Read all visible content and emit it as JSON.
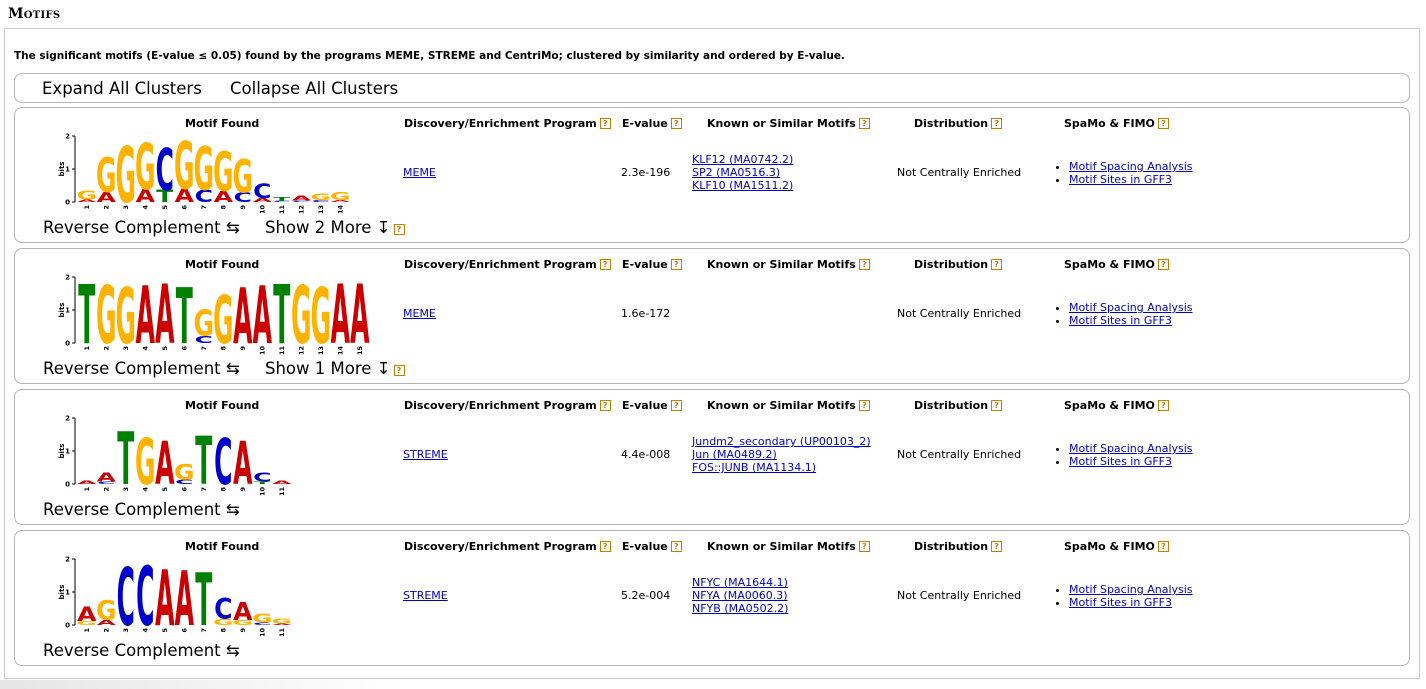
{
  "section": {
    "title": "Motifs"
  },
  "description": "The significant motifs (E-value ≤ 0.05) found by the programs MEME, STREME and CentriMo; clustered by similarity and ordered by E-value.",
  "cluster_controls": {
    "expand": "Expand All Clusters",
    "collapse": "Collapse All Clusters"
  },
  "headers": {
    "motif": "Motif Found",
    "program": "Discovery/Enrichment Program",
    "evalue": "E-value",
    "known": "Known or Similar Motifs",
    "distribution": "Distribution",
    "spamo": "SpaMo & FIMO",
    "help_glyph": "?"
  },
  "controls": {
    "reverse_complement": "Reverse Complement ⇆",
    "more_glyph": "↧"
  },
  "colors": {
    "A": "#cc0000",
    "C": "#0000cc",
    "G": "#ffb300",
    "T": "#008000",
    "help": "#cc7a00",
    "link": "#0000cc"
  },
  "logo_axis": {
    "unit": "bits",
    "ticks": [
      "0",
      "1",
      "2"
    ]
  },
  "motifs": [
    {
      "program": "MEME",
      "evalue": "2.3e-196",
      "known": [
        "KLF12 (MA0742.2)",
        "SP2 (MA0516.3)",
        "KLF10 (MA1511.2)"
      ],
      "distribution": "Not Centrally Enriched",
      "spamo": [
        "Motif Spacing Analysis",
        "Motif Sites in GFF3"
      ],
      "show_more": "Show 2 More",
      "positions": [
        "1",
        "2",
        "3",
        "4",
        "5",
        "6",
        "7",
        "8",
        "9",
        "10",
        "11",
        "12",
        "13",
        "14"
      ],
      "logo": [
        [
          "G",
          "A"
        ],
        [
          "G",
          "A"
        ],
        [
          "G"
        ],
        [
          "G",
          "A"
        ],
        [
          "C",
          "T"
        ],
        [
          "G",
          "A"
        ],
        [
          "G",
          "C"
        ],
        [
          "G",
          "A"
        ],
        [
          "G",
          "C"
        ],
        [
          "C",
          "A"
        ],
        [
          "T",
          "C"
        ],
        [
          "A",
          "C"
        ],
        [
          "G",
          "C"
        ],
        [
          "G",
          "A"
        ]
      ],
      "logo_heights": [
        0.35,
        1.35,
        1.7,
        1.8,
        1.65,
        1.85,
        1.7,
        1.55,
        1.3,
        0.55,
        0.15,
        0.2,
        0.25,
        0.3
      ]
    },
    {
      "program": "MEME",
      "evalue": "1.6e-172",
      "known": [],
      "distribution": "Not Centrally Enriched",
      "spamo": [
        "Motif Spacing Analysis",
        "Motif Sites in GFF3"
      ],
      "show_more": "Show 1 More",
      "positions": [
        "1",
        "2",
        "3",
        "4",
        "5",
        "6",
        "7",
        "8",
        "9",
        "10",
        "11",
        "12",
        "13",
        "14",
        "15"
      ],
      "logo": [
        [
          "T"
        ],
        [
          "G"
        ],
        [
          "G"
        ],
        [
          "A"
        ],
        [
          "A"
        ],
        [
          "T"
        ],
        [
          "G",
          "C"
        ],
        [
          "G"
        ],
        [
          "A"
        ],
        [
          "A"
        ],
        [
          "T"
        ],
        [
          "G"
        ],
        [
          "G"
        ],
        [
          "A"
        ],
        [
          "A"
        ]
      ],
      "logo_heights": [
        1.8,
        1.75,
        1.7,
        1.75,
        1.8,
        1.7,
        1.0,
        1.45,
        1.7,
        1.75,
        1.8,
        1.75,
        1.7,
        1.8,
        1.8
      ]
    },
    {
      "program": "STREME",
      "evalue": "4.4e-008",
      "known": [
        "Jundm2_secondary (UP00103_2)",
        "Jun (MA0489.2)",
        "FOS::JUNB (MA1134.1)"
      ],
      "distribution": "Not Centrally Enriched",
      "spamo": [
        "Motif Spacing Analysis",
        "Motif Sites in GFF3"
      ],
      "show_more": "",
      "positions": [
        "1",
        "2",
        "3",
        "4",
        "5",
        "6",
        "7",
        "8",
        "9",
        "10",
        "11"
      ],
      "logo": [
        [
          "A"
        ],
        [
          "A",
          "C"
        ],
        [
          "T"
        ],
        [
          "G"
        ],
        [
          "A"
        ],
        [
          "G",
          "C"
        ],
        [
          "T"
        ],
        [
          "C"
        ],
        [
          "A"
        ],
        [
          "C",
          "T"
        ],
        [
          "A"
        ]
      ],
      "logo_heights": [
        0.1,
        0.35,
        1.6,
        1.4,
        1.3,
        0.6,
        1.45,
        1.4,
        1.3,
        0.35,
        0.1
      ]
    },
    {
      "program": "STREME",
      "evalue": "5.2e-004",
      "known": [
        "NFYC (MA1644.1)",
        "NFYA (MA0060.3)",
        "NFYB (MA0502.2)"
      ],
      "distribution": "Not Centrally Enriched",
      "spamo": [
        "Motif Spacing Analysis",
        "Motif Sites in GFF3"
      ],
      "show_more": "",
      "positions": [
        "1",
        "2",
        "3",
        "4",
        "5",
        "6",
        "7",
        "8",
        "9",
        "10",
        "11"
      ],
      "logo": [
        [
          "A",
          "G"
        ],
        [
          "G",
          "A"
        ],
        [
          "C"
        ],
        [
          "C"
        ],
        [
          "A"
        ],
        [
          "A"
        ],
        [
          "T"
        ],
        [
          "C",
          "G"
        ],
        [
          "A",
          "G"
        ],
        [
          "G",
          "C"
        ],
        [
          "G",
          "A"
        ]
      ],
      "logo_heights": [
        0.55,
        0.75,
        1.75,
        1.8,
        1.7,
        1.65,
        1.6,
        0.8,
        0.7,
        0.35,
        0.2
      ]
    }
  ]
}
